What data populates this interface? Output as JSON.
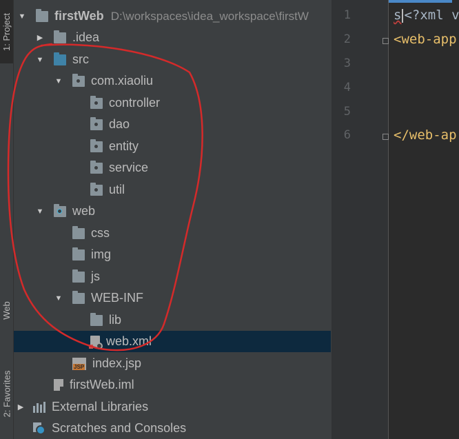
{
  "tool_strip": {
    "project_tab": "1: Project",
    "web_tab": "Web",
    "favorites_tab": "2: Favorites"
  },
  "tree": {
    "root": {
      "name": "firstWeb",
      "path": "D:\\workspaces\\idea_workspace\\firstW"
    },
    "idea": ".idea",
    "src": "src",
    "package": "com.xiaoliu",
    "pkg_children": [
      "controller",
      "dao",
      "entity",
      "service",
      "util"
    ],
    "web": "web",
    "web_children": [
      "css",
      "img",
      "js"
    ],
    "webinf": "WEB-INF",
    "lib": "lib",
    "webxml": "web.xml",
    "indexjsp": "index.jsp",
    "jsp_badge": "JSP",
    "iml": "firstWeb.iml",
    "external": "External Libraries",
    "scratches": "Scratches and Consoles"
  },
  "editor": {
    "line_numbers": [
      "1",
      "2",
      "3",
      "4",
      "5",
      "6"
    ],
    "line1_prefix": "s",
    "line1_code": "<?xml v",
    "line2_code": "<web-app",
    "line6_code": "</web-ap"
  },
  "colors": {
    "annotation": "#d42a2a",
    "selection": "#0d293e",
    "source_folder": "#3f83a8"
  }
}
